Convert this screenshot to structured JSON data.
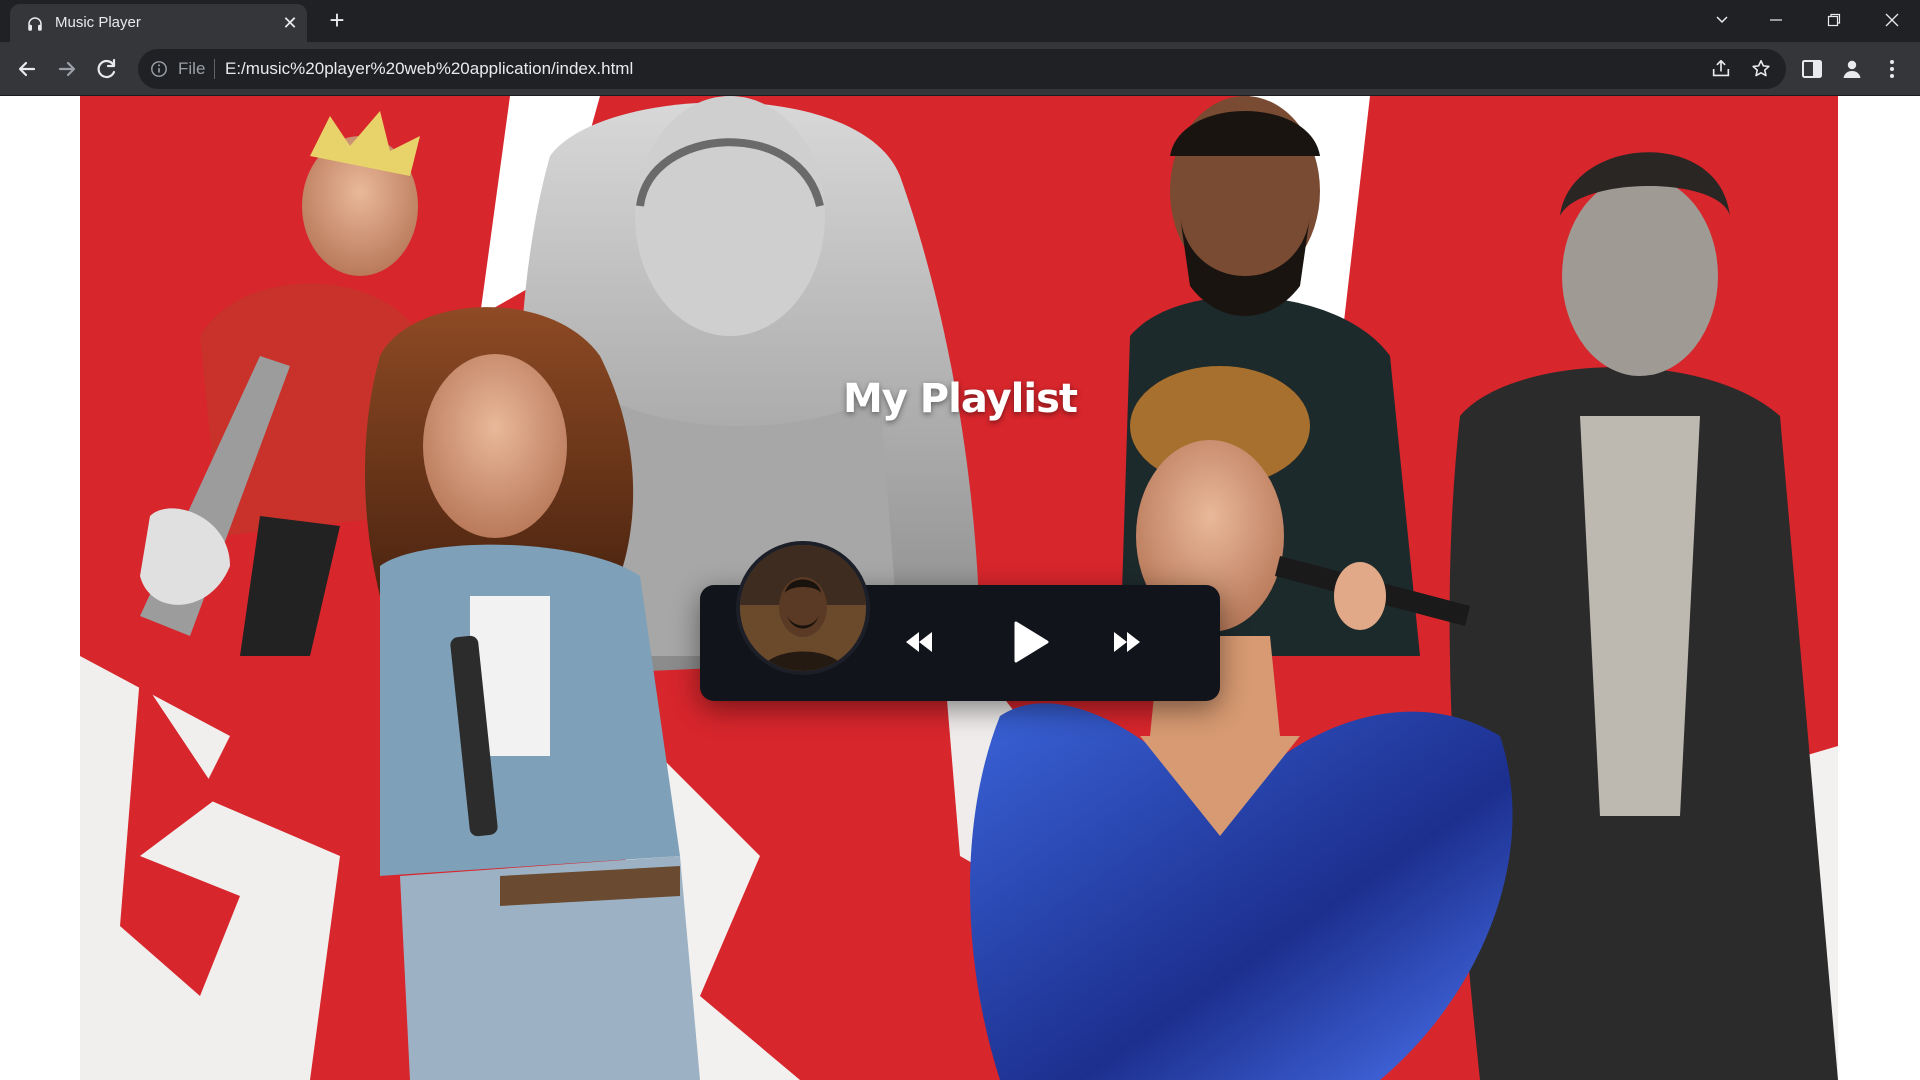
{
  "browser": {
    "tab_title": "Music Player",
    "tab_icon": "headphones-icon",
    "file_label": "File",
    "url": "E:/music%20player%20web%20application/index.html"
  },
  "page": {
    "title": "My Playlist"
  },
  "player": {
    "album_art": "album-art-image",
    "controls": [
      "previous-icon",
      "play-icon",
      "next-icon"
    ],
    "background_color": "#12141c"
  },
  "colors": {
    "flag_red": "#d7262c",
    "flag_white": "#ffffff",
    "chrome_dark": "#202124",
    "chrome_mid": "#35363a"
  }
}
